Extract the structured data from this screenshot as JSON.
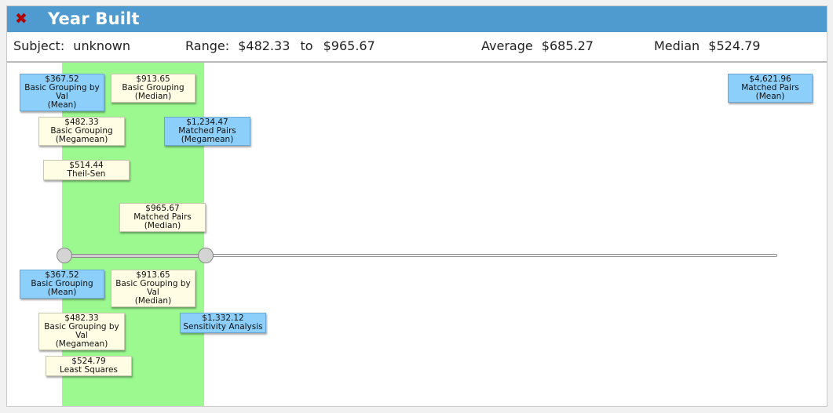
{
  "window": {
    "title": "Year Built",
    "close_icon": "close-icon"
  },
  "info": {
    "subject_label": "Subject:",
    "subject_value": "unknown",
    "range_label": "Range:",
    "range_low": "$482.33",
    "range_to": "to",
    "range_high": "$965.67",
    "average_label": "Average",
    "average_value": "$685.27",
    "median_label": "Median",
    "median_value": "$524.79"
  },
  "slider": {
    "low_value": "$482.33",
    "high_value": "$965.67"
  },
  "tags_top": [
    {
      "value": "$367.52",
      "label": "Basic Grouping by Val",
      "stat": "(Mean)",
      "color": "blue"
    },
    {
      "value": "$913.65",
      "label": "Basic Grouping",
      "stat": "(Median)",
      "color": "yellow"
    },
    {
      "value": "$4,621.96",
      "label": "Matched Pairs",
      "stat": "(Mean)",
      "color": "blue"
    },
    {
      "value": "$482.33",
      "label": "Basic Grouping",
      "stat": "(Megamean)",
      "color": "yellow"
    },
    {
      "value": "$1,234.47",
      "label": "Matched Pairs",
      "stat": "(Megamean)",
      "color": "blue"
    },
    {
      "value": "$514.44",
      "label": "Theil-Sen",
      "stat": "",
      "color": "yellow"
    },
    {
      "value": "$965.67",
      "label": "Matched Pairs",
      "stat": "(Median)",
      "color": "yellow"
    }
  ],
  "tags_bottom": [
    {
      "value": "$367.52",
      "label": "Basic Grouping",
      "stat": "(Mean)",
      "color": "blue"
    },
    {
      "value": "$913.65",
      "label": "Basic Grouping by Val",
      "stat": "(Median)",
      "color": "yellow"
    },
    {
      "value": "$482.33",
      "label": "Basic Grouping by Val",
      "stat": "(Megamean)",
      "color": "yellow"
    },
    {
      "value": "$1,332.12",
      "label": "Sensitivity Analysis",
      "stat": "",
      "color": "blue"
    },
    {
      "value": "$524.79",
      "label": "Least Squares",
      "stat": "",
      "color": "yellow"
    }
  ]
}
